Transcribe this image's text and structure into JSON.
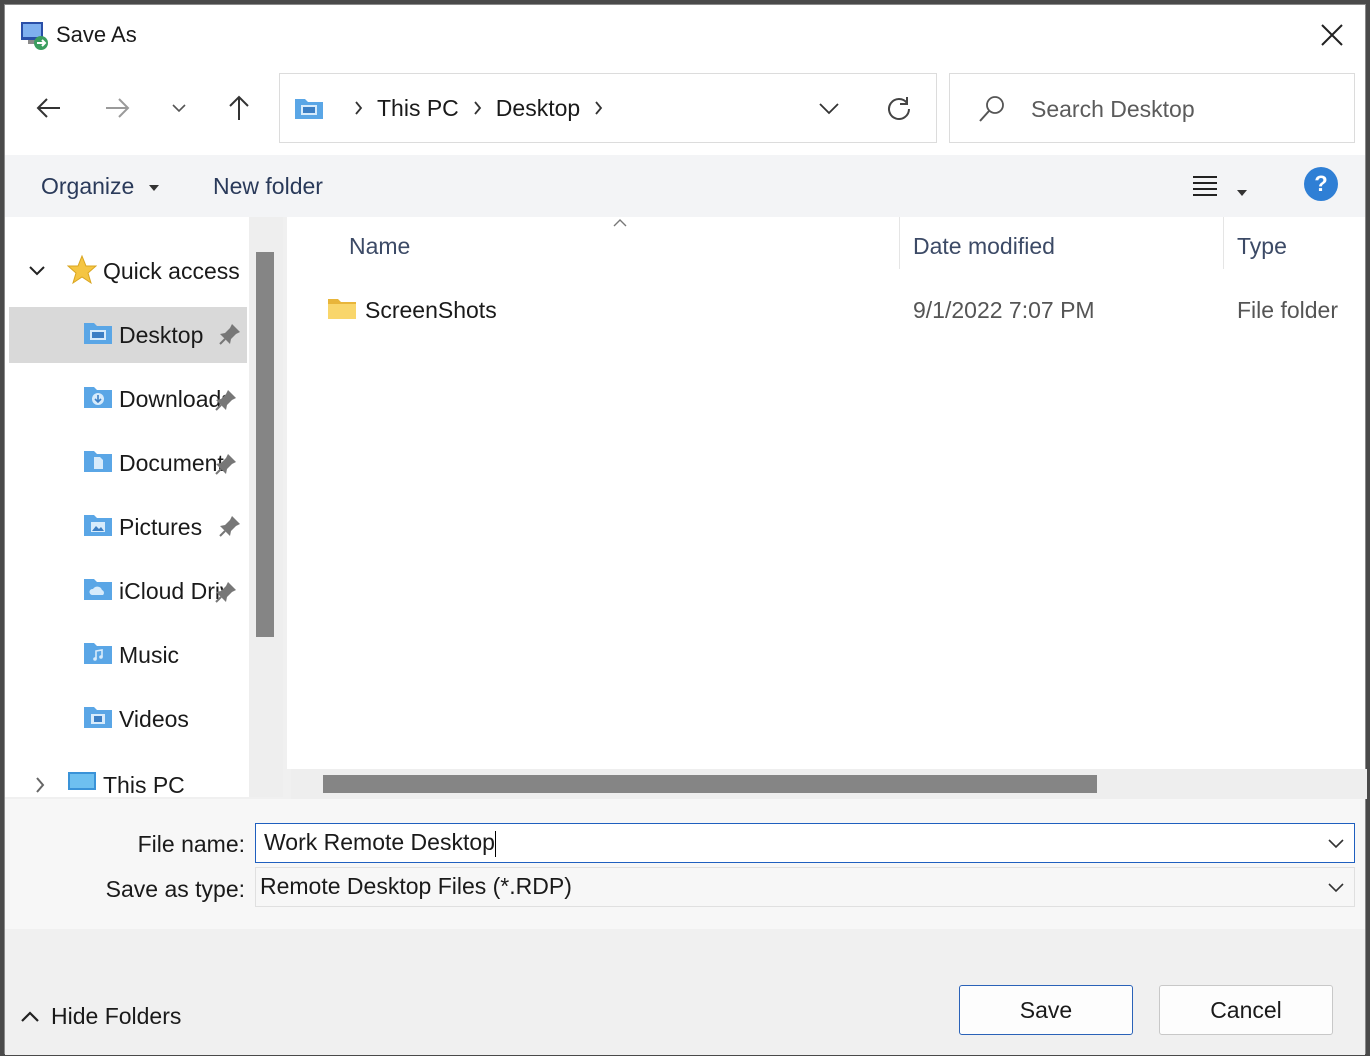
{
  "window": {
    "title": "Save As"
  },
  "addressbar": {
    "crumbs": [
      "This PC",
      "Desktop"
    ]
  },
  "search": {
    "placeholder": "Search Desktop"
  },
  "toolbar": {
    "organize": "Organize",
    "new_folder": "New folder",
    "help": "?"
  },
  "navpane": {
    "quick_access": "Quick access",
    "items": [
      {
        "label": "Desktop",
        "icon": "desktop-folder-icon",
        "pinned": true
      },
      {
        "label": "Downloads",
        "icon": "downloads-folder-icon",
        "pinned": true
      },
      {
        "label": "Documents",
        "icon": "documents-folder-icon",
        "pinned": true
      },
      {
        "label": "Pictures",
        "icon": "pictures-folder-icon",
        "pinned": true
      },
      {
        "label": "iCloud Drive",
        "icon": "icloud-folder-icon",
        "pinned": true
      },
      {
        "label": "Music",
        "icon": "music-folder-icon",
        "pinned": false
      },
      {
        "label": "Videos",
        "icon": "videos-folder-icon",
        "pinned": false
      }
    ],
    "this_pc": "This PC"
  },
  "filelist": {
    "columns": [
      "Name",
      "Date modified",
      "Type"
    ],
    "rows": [
      {
        "name": "ScreenShots",
        "date": "9/1/2022 7:07 PM",
        "type": "File folder"
      }
    ]
  },
  "fields": {
    "file_name_label": "File name:",
    "file_name_value": "Work Remote Desktop",
    "save_type_label": "Save as type:",
    "save_type_value": "Remote Desktop Files (*.RDP)"
  },
  "footer": {
    "hide_folders": "Hide Folders",
    "save": "Save",
    "cancel": "Cancel"
  },
  "colors": {
    "accent": "#2f7fd5",
    "folder_blue": "#5aa6e6",
    "folder_yellow": "#f5c542"
  }
}
